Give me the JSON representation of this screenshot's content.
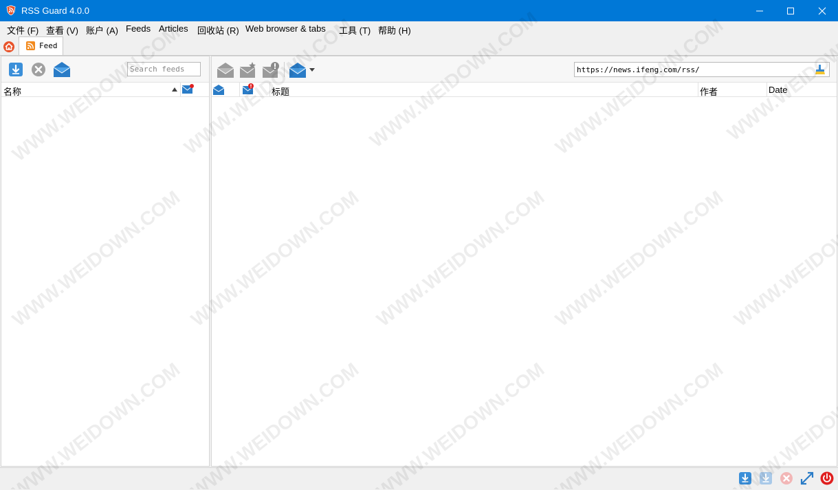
{
  "window": {
    "title": "RSS Guard 4.0.0"
  },
  "menu": {
    "items": [
      {
        "label": "文件 (F)"
      },
      {
        "label": "查看 (V)"
      },
      {
        "label": "账户 (A)"
      },
      {
        "label": "Feeds"
      },
      {
        "label": "Articles"
      },
      {
        "label": "回收站 (R)"
      },
      {
        "label": "Web browser & tabs"
      },
      {
        "label": "工具 (T)"
      },
      {
        "label": "帮助 (H)"
      }
    ]
  },
  "tabs": {
    "home_icon": "home-icon",
    "feed_tab_label": "Feed"
  },
  "feeds_panel": {
    "search_placeholder": "Search feeds",
    "header_name": "名称",
    "toolbar_icons": [
      "update-feeds-icon",
      "stop-icon",
      "mark-read-icon"
    ]
  },
  "articles_panel": {
    "url": "https://news.ifeng.com/rss/",
    "header_title": "标题",
    "header_author": "作者",
    "header_date": "Date",
    "toolbar_icons": [
      "mark-read-icon",
      "mark-starred-icon",
      "mark-important-icon",
      "mark-unread-icon"
    ]
  },
  "statusbar": {
    "icons": [
      "update-all-icon",
      "update-selected-icon",
      "stop-update-icon",
      "fullscreen-icon",
      "quit-icon"
    ]
  },
  "watermark": "WWW.WEIDOWN.COM",
  "colors": {
    "titlebar": "#0078d7",
    "accent_blue": "#1e88e5",
    "rss_orange": "#f28a1e",
    "quit_red": "#e02020"
  }
}
